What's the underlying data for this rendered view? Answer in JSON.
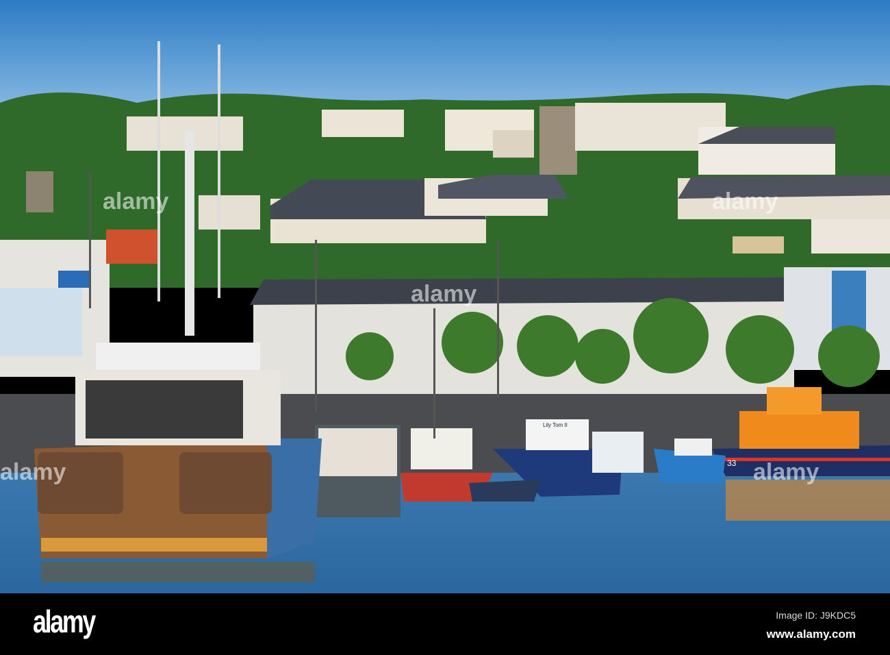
{
  "photo": {
    "boat_names": [
      "Lily Tom II"
    ],
    "lifeboat_number": "33",
    "colors": {
      "sky_top": "#2d7bc4",
      "sky_bottom": "#8fc0e6",
      "water": "#2f6fa8",
      "lifeboat": "#f08a1c",
      "trees": "#2f6a2a"
    }
  },
  "footer": {
    "brand": "alamy",
    "image_id": "Image ID: J9KDC5",
    "url": "www.alamy.com"
  }
}
